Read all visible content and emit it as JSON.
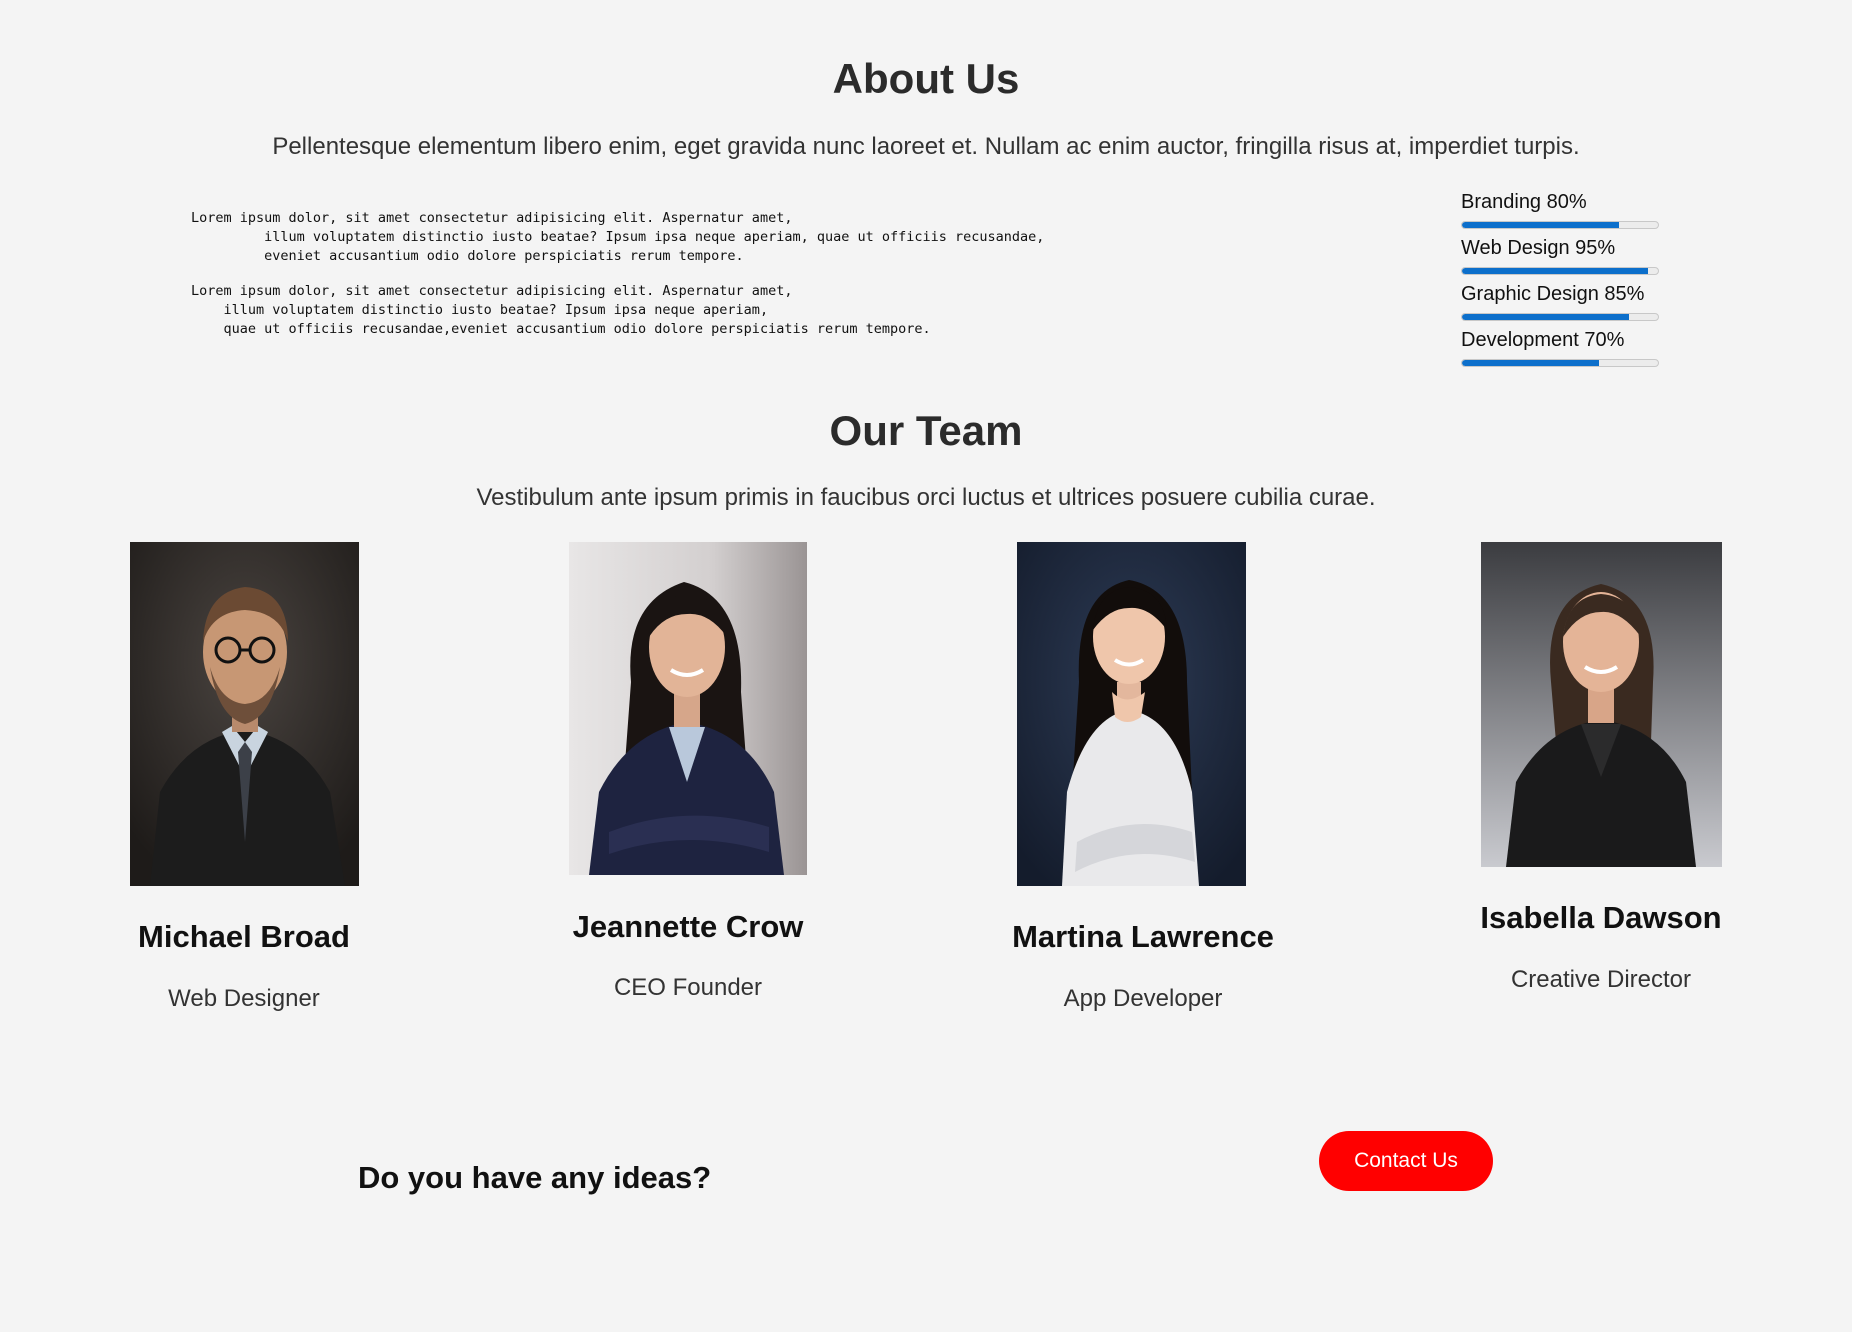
{
  "about": {
    "title": "About Us",
    "subtitle": "Pellentesque elementum libero enim, eget gravida nunc laoreet et. Nullam ac enim auctor, fringilla risus at, imperdiet turpis.",
    "paragraph_1": "Lorem ipsum dolor, sit amet consectetur adipisicing elit. Aspernatur amet,\n         illum voluptatem distinctio iusto beatae? Ipsum ipsa neque aperiam, quae ut officiis recusandae,\n         eveniet accusantium odio dolore perspiciatis rerum tempore.",
    "paragraph_2": "Lorem ipsum dolor, sit amet consectetur adipisicing elit. Aspernatur amet,\n    illum voluptatem distinctio iusto beatae? Ipsum ipsa neque aperiam,\n    quae ut officiis recusandae,eveniet accusantium odio dolore perspiciatis rerum tempore.",
    "skills": [
      {
        "label": "Branding 80%",
        "value": 80
      },
      {
        "label": "Web Design 95%",
        "value": 95
      },
      {
        "label": "Graphic Design 85%",
        "value": 85
      },
      {
        "label": "Development 70%",
        "value": 70
      }
    ]
  },
  "team": {
    "title": "Our Team",
    "subtitle": "Vestibulum ante ipsum primis in faucibus orci luctus et ultrices posuere cubilia curae.",
    "members": [
      {
        "name": "Michael Broad",
        "role": "Web Designer"
      },
      {
        "name": "Jeannette Crow",
        "role": "CEO Founder"
      },
      {
        "name": "Martina Lawrence",
        "role": "App Developer"
      },
      {
        "name": "Isabella Dawson",
        "role": "Creative Director"
      }
    ]
  },
  "cta": {
    "question": "Do you have any ideas?",
    "button_label": "Contact Us"
  },
  "colors": {
    "page_background": "#f4f4f4",
    "progress_fill": "#0c6fcb",
    "button": "#ff0000"
  }
}
